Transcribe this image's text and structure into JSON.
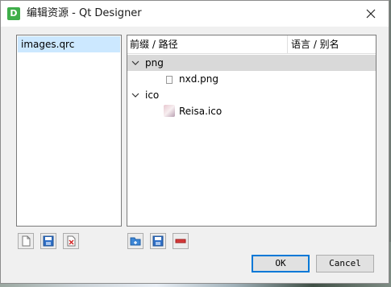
{
  "window": {
    "title": "编辑资源 - Qt Designer",
    "app_icon_letter": "D"
  },
  "resource_files": [
    {
      "name": "images.qrc",
      "selected": true
    }
  ],
  "tree": {
    "header": {
      "col_prefix_path": "前缀 / 路径",
      "col_lang_alias": "语言 / 别名"
    },
    "prefixes": [
      {
        "name": "png",
        "expanded": true,
        "selected": true,
        "files": [
          {
            "name": "nxd.png"
          }
        ]
      },
      {
        "name": "ico",
        "expanded": true,
        "selected": false,
        "files": [
          {
            "name": "Reisa.ico"
          }
        ]
      }
    ]
  },
  "left_toolbar": [
    "new-file-icon",
    "save-file-icon",
    "remove-file-icon"
  ],
  "right_toolbar": [
    "add-prefix-icon",
    "add-files-icon",
    "remove-icon"
  ],
  "buttons": {
    "ok": "OK",
    "cancel": "Cancel"
  },
  "colors": {
    "selection": "#cce8ff",
    "tree_selection": "#d9d9d9",
    "accent": "#0078d7",
    "app_icon": "#3fae4a"
  }
}
